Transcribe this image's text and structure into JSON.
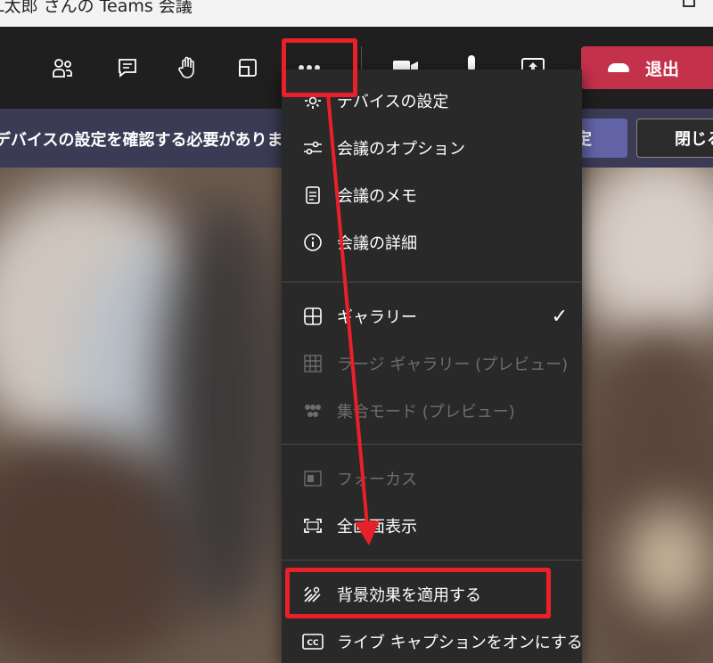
{
  "window": {
    "title": "L太郎 さんの Teams 会議"
  },
  "toolbar": {
    "icons": [
      "participants-icon",
      "chat-icon",
      "raise-hand-icon",
      "share-tray-icon",
      "more-actions-icon",
      "camera-icon",
      "mic-icon",
      "share-screen-icon"
    ],
    "leave_label": "退出"
  },
  "notice": {
    "message": "デバイスの設定を確認する必要がありま",
    "primary_label": "定",
    "close_label": "閉じる"
  },
  "menu": {
    "items": [
      {
        "label": "デバイスの設定",
        "icon": "gear-icon",
        "enabled": true
      },
      {
        "label": "会議のオプション",
        "icon": "sliders-icon",
        "enabled": true
      },
      {
        "label": "会議のメモ",
        "icon": "notes-icon",
        "enabled": true
      },
      {
        "label": "会議の詳細",
        "icon": "info-icon",
        "enabled": true
      },
      {
        "label": "ギャラリー",
        "icon": "grid-icon",
        "enabled": true,
        "checked": true
      },
      {
        "label": "ラージ ギャラリー (プレビュー)",
        "icon": "large-grid-icon",
        "enabled": false
      },
      {
        "label": "集合モード (プレビュー)",
        "icon": "together-icon",
        "enabled": false
      },
      {
        "label": "フォーカス",
        "icon": "focus-icon",
        "enabled": false
      },
      {
        "label": "全画面表示",
        "icon": "fullscreen-icon",
        "enabled": true
      },
      {
        "label": "背景効果を適用する",
        "icon": "background-effects-icon",
        "enabled": true
      },
      {
        "label": "ライブ キャプションをオンにする",
        "icon": "cc-icon",
        "enabled": true
      }
    ],
    "check_mark": "✓"
  },
  "colors": {
    "leave": "#c4314b",
    "primary": "#6264a7",
    "highlight": "#e8202a",
    "menu_bg": "#292929"
  }
}
